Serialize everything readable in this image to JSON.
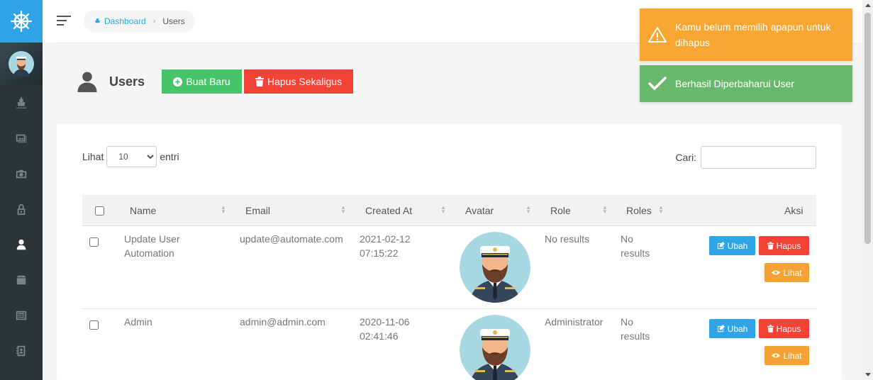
{
  "breadcrumb": {
    "home": "Dashboard",
    "current": "Users"
  },
  "page": {
    "title": "Users",
    "create_label": "Buat Baru",
    "bulk_delete_label": "Hapus Sekaligus"
  },
  "table_controls": {
    "length_prefix": "Lihat",
    "length_value": "10",
    "length_suffix": "entri",
    "search_label": "Cari:",
    "search_value": ""
  },
  "columns": [
    "Name",
    "Email",
    "Created At",
    "Avatar",
    "Role",
    "Roles",
    "Aksi"
  ],
  "rows": [
    {
      "name_line1": "Update User",
      "name_line2": "Automation",
      "email": "update@automate.com",
      "created_date": "2021-02-12",
      "created_time": "07:15:22",
      "role": "No results",
      "roles_line1": "No",
      "roles_line2": "results"
    },
    {
      "name_line1": "Admin",
      "name_line2": "",
      "email": "admin@admin.com",
      "created_date": "2020-11-06",
      "created_time": "02:41:46",
      "role": "Administrator",
      "roles_line1": "No",
      "roles_line2": "results"
    }
  ],
  "actions": {
    "edit": "Ubah",
    "delete": "Hapus",
    "view": "Lihat"
  },
  "toasts": {
    "warning": "Kamu belum memilih apapun untuk dihapus",
    "success": "Berhasil Diperbaharui User"
  },
  "colors": {
    "primary": "#2fa4e7",
    "success": "#47c46b",
    "danger": "#f44336",
    "warning": "#f4a233",
    "sidebar": "#2d3438"
  },
  "icons": [
    "ship-wheel-icon",
    "ship-icon",
    "image-icon",
    "camera-icon",
    "lock-icon",
    "user-icon",
    "box-icon",
    "newspaper-icon",
    "contacts-icon",
    "plus-circle-icon",
    "trash-icon",
    "edit-icon",
    "eye-icon",
    "warning-icon",
    "check-icon"
  ]
}
